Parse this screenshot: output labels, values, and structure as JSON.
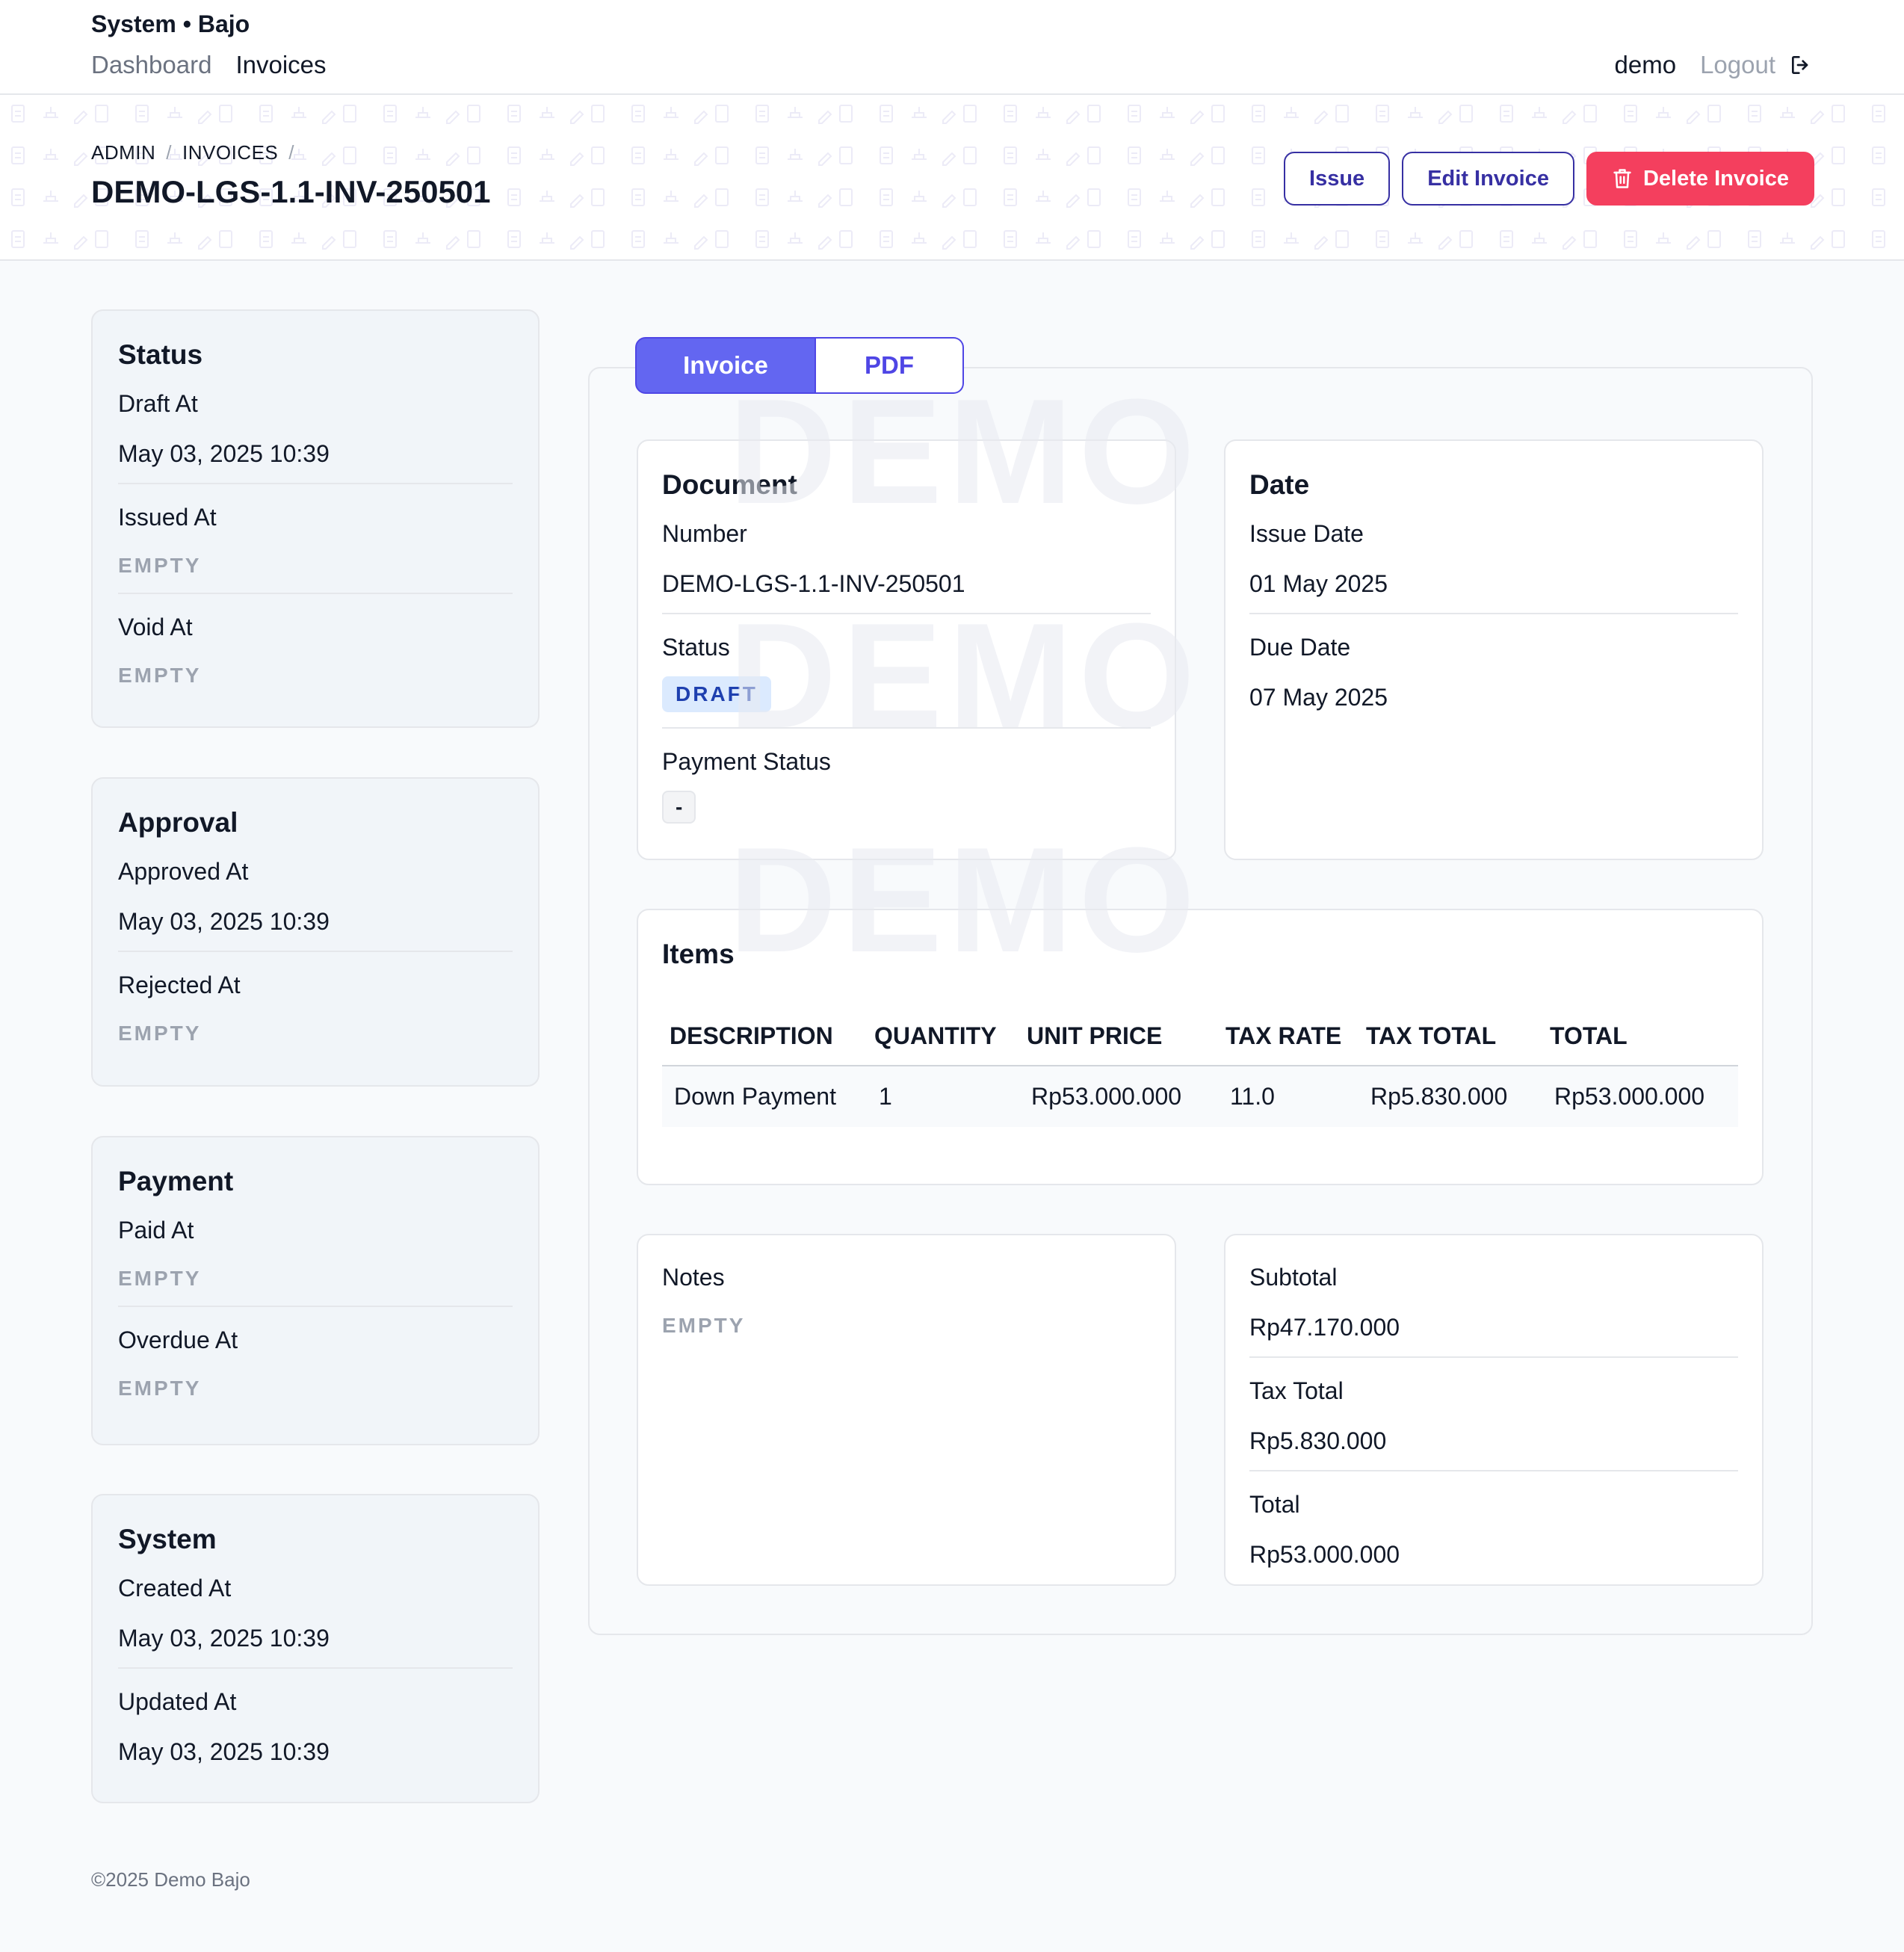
{
  "app": {
    "title": "System • Bajo"
  },
  "nav": {
    "items": [
      {
        "label": "Dashboard"
      },
      {
        "label": "Invoices"
      }
    ]
  },
  "user": {
    "name": "demo",
    "logout_label": "Logout"
  },
  "breadcrumb": {
    "items": [
      "ADMIN",
      "INVOICES"
    ],
    "separator": "/"
  },
  "page": {
    "title": "DEMO-LGS-1.1-INV-250501"
  },
  "actions": {
    "issue_label": "Issue",
    "edit_label": "Edit Invoice",
    "delete_label": "Delete Invoice"
  },
  "empty_text": "EMPTY",
  "sidebar": {
    "status": {
      "title": "Status",
      "draft_at": {
        "label": "Draft At",
        "value": "May 03, 2025 10:39"
      },
      "issued_at": {
        "label": "Issued At"
      },
      "void_at": {
        "label": "Void At"
      }
    },
    "approval": {
      "title": "Approval",
      "approved_at": {
        "label": "Approved At",
        "value": "May 03, 2025 10:39"
      },
      "rejected_at": {
        "label": "Rejected At"
      }
    },
    "payment": {
      "title": "Payment",
      "paid_at": {
        "label": "Paid At"
      },
      "overdue_at": {
        "label": "Overdue At"
      }
    },
    "system": {
      "title": "System",
      "created_at": {
        "label": "Created At",
        "value": "May 03, 2025 10:39"
      },
      "updated_at": {
        "label": "Updated At",
        "value": "May 03, 2025 10:39"
      }
    }
  },
  "tabs": {
    "invoice": "Invoice",
    "pdf": "PDF"
  },
  "watermark": "DEMO",
  "document": {
    "title": "Document",
    "number_label": "Number",
    "number": "DEMO-LGS-1.1-INV-250501",
    "status_label": "Status",
    "status": "DRAFT",
    "payment_status_label": "Payment Status",
    "payment_status": "-"
  },
  "date": {
    "title": "Date",
    "issue_label": "Issue Date",
    "issue": "01 May 2025",
    "due_label": "Due Date",
    "due": "07 May 2025"
  },
  "items": {
    "title": "Items",
    "headers": [
      "DESCRIPTION",
      "QUANTITY",
      "UNIT PRICE",
      "TAX RATE",
      "TAX TOTAL",
      "TOTAL"
    ],
    "rows": [
      [
        "Down Payment",
        "1",
        "Rp53.000.000",
        "11.0",
        "Rp5.830.000",
        "Rp53.000.000"
      ]
    ]
  },
  "notes": {
    "label": "Notes"
  },
  "totals": {
    "subtotal_label": "Subtotal",
    "subtotal": "Rp47.170.000",
    "tax_label": "Tax Total",
    "tax": "Rp5.830.000",
    "total_label": "Total",
    "total": "Rp53.000.000"
  },
  "footer": {
    "text": "©2025 Demo Bajo"
  },
  "colors": {
    "accent": "#6366f1",
    "danger": "#f43f5e",
    "draft_badge_bg": "#dbeafe",
    "draft_badge_fg": "#1e40af"
  }
}
